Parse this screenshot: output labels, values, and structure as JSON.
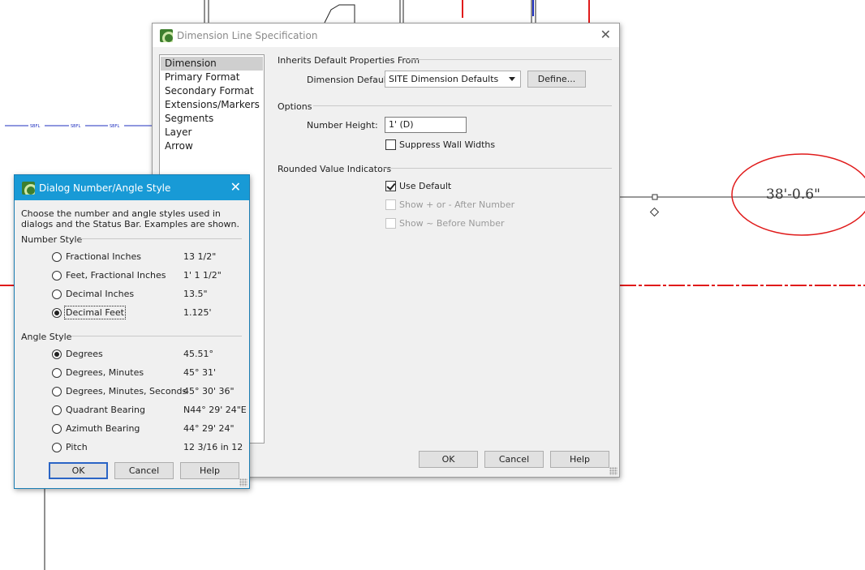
{
  "background": {
    "dimension_text": "38'-0.6\"",
    "site_labels": [
      "SBFL",
      "SBFL",
      "SBFL"
    ],
    "colors": {
      "red": "#e01b1b",
      "blue": "#1f2fbf",
      "black": "#222222"
    }
  },
  "main_dialog": {
    "title": "Dimension Line Specification",
    "close_icon": "close-icon",
    "nav_items": [
      "Dimension",
      "Primary Format",
      "Secondary Format",
      "Extensions/Markers",
      "Segments",
      "Layer",
      "Arrow"
    ],
    "selected_nav_index": 0,
    "inherits": {
      "title": "Inherits Default Properties From",
      "default_label": "Dimension Default:",
      "default_value": "SITE Dimension Defaults",
      "define_button": "Define..."
    },
    "options": {
      "title": "Options",
      "number_height_label": "Number Height:",
      "number_height_value": "1' (D)",
      "suppress_label": "Suppress Wall Widths",
      "suppress_checked": false
    },
    "rounded": {
      "title": "Rounded Value Indicators",
      "use_default_label": "Use Default",
      "use_default_checked": true,
      "show_plus_label": "Show + or - After Number",
      "show_tilde_label": "Show ~ Before Number"
    },
    "buttons": {
      "ok": "OK",
      "cancel": "Cancel",
      "help": "Help"
    }
  },
  "number_dialog": {
    "title": "Dialog Number/Angle Style",
    "close_icon": "close-icon",
    "description": "Choose the number and angle styles used in dialogs and the Status Bar.  Examples are shown.",
    "number_style": {
      "title": "Number Style",
      "options": [
        {
          "label": "Fractional Inches",
          "example": "13 1/2\"",
          "selected": false
        },
        {
          "label": "Feet, Fractional Inches",
          "example": "1' 1 1/2\"",
          "selected": false
        },
        {
          "label": "Decimal Inches",
          "example": "13.5\"",
          "selected": false
        },
        {
          "label": "Decimal Feet",
          "example": "1.125'",
          "selected": true
        }
      ]
    },
    "angle_style": {
      "title": "Angle Style",
      "options": [
        {
          "label": "Degrees",
          "example": "45.51°",
          "selected": true
        },
        {
          "label": "Degrees, Minutes",
          "example": "45° 31'",
          "selected": false
        },
        {
          "label": "Degrees, Minutes, Seconds",
          "example": "45° 30' 36\"",
          "selected": false
        },
        {
          "label": "Quadrant Bearing",
          "example": "N44° 29' 24\"E",
          "selected": false
        },
        {
          "label": "Azimuth Bearing",
          "example": "44° 29' 24\"",
          "selected": false
        },
        {
          "label": "Pitch",
          "example": "12 3/16 in 12",
          "selected": false
        }
      ]
    },
    "buttons": {
      "ok": "OK",
      "cancel": "Cancel",
      "help": "Help"
    }
  }
}
